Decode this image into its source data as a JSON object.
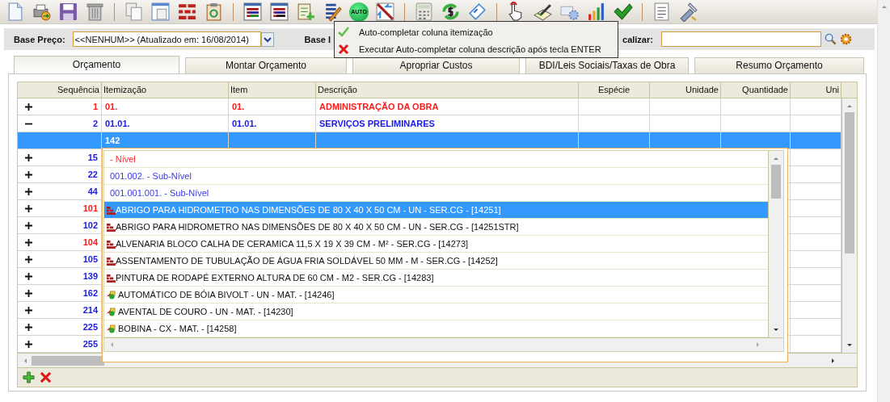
{
  "toolbar": {
    "auto_label": "AUTO"
  },
  "menu": [
    {
      "label": "Auto-completar coluna itemização",
      "checked": true
    },
    {
      "label": "Executar Auto-completar coluna descrição após tecla ENTER",
      "checked": false
    }
  ],
  "filters": {
    "price_base_label": "Base Preço:",
    "price_base_value": "<<NENHUM>> (Atualizado em: 16/08/2014)",
    "label_2": "Base I",
    "search_label": "calizar:"
  },
  "tabs": [
    {
      "label": "Orçamento",
      "selected": true
    },
    {
      "label": "Montar Orçamento",
      "selected": false
    },
    {
      "label": "Apropriar Custos",
      "selected": false
    },
    {
      "label": "BDI/Leis Sociais/Taxas de Obra",
      "selected": false
    },
    {
      "label": "Resumo Orçamento",
      "selected": false
    }
  ],
  "grid": {
    "columns": [
      "Sequência",
      "Itemização",
      "Item",
      "Descrição",
      "Espécie",
      "Unidade",
      "Quantidade",
      "Uni"
    ],
    "rows": [
      {
        "kind": "node",
        "expanded": false,
        "sequence": "1",
        "itemization": "01.",
        "item": "01.",
        "description": "ADMINISTRAÇÃO DA OBRA",
        "color": "#ff1a1a"
      },
      {
        "kind": "node",
        "expanded": true,
        "sequence": "2",
        "itemization": "01.01.",
        "item": "01.01.",
        "description": "SERVIÇOS PRELIMINARES",
        "color": "#1a1ae6"
      },
      {
        "kind": "edit",
        "itemization": "142"
      },
      {
        "kind": "node",
        "expanded": false,
        "sequence": "15",
        "color": "#1a1ae6"
      },
      {
        "kind": "node",
        "expanded": false,
        "sequence": "22",
        "color": "#1a1ae6"
      },
      {
        "kind": "node",
        "expanded": false,
        "sequence": "44",
        "color": "#1a1ae6"
      },
      {
        "kind": "node",
        "expanded": false,
        "sequence": "101",
        "color": "#ff1a1a"
      },
      {
        "kind": "node",
        "expanded": false,
        "sequence": "102",
        "color": "#1a1ae6"
      },
      {
        "kind": "node",
        "expanded": false,
        "sequence": "104",
        "color": "#ff1a1a"
      },
      {
        "kind": "node",
        "expanded": false,
        "sequence": "105",
        "color": "#1a1ae6"
      },
      {
        "kind": "node",
        "expanded": false,
        "sequence": "139",
        "color": "#1a1ae6"
      },
      {
        "kind": "node",
        "expanded": false,
        "sequence": "162",
        "color": "#1a1ae6"
      },
      {
        "kind": "node",
        "expanded": false,
        "sequence": "214",
        "color": "#1a1ae6"
      },
      {
        "kind": "node",
        "expanded": false,
        "sequence": "225",
        "color": "#1a1ae6"
      },
      {
        "kind": "node",
        "expanded": false,
        "sequence": "255",
        "color": "#1a1ae6"
      }
    ]
  },
  "autocomplete": {
    "items": [
      {
        "kind": "level",
        "text": "- Nível",
        "color": "#ff2a2a",
        "selected": false
      },
      {
        "kind": "level",
        "text": "001.002. - Sub-Nível",
        "color": "#3a3ae0",
        "selected": false
      },
      {
        "kind": "level",
        "text": "001.001.001. - Sub-Nível",
        "color": "#3a3ae0",
        "selected": false
      },
      {
        "kind": "service",
        "text": "ABRIGO PARA HIDROMETRO NAS DIMENSÕES DE 80 X 40 X 50 CM - UN - SER.CG - [14251]",
        "selected": true
      },
      {
        "kind": "service",
        "text": "ABRIGO PARA HIDROMETRO NAS DIMENSÕES DE 80 X 40 X 50 CM - UN - SER.CG - [14251STR]",
        "selected": false
      },
      {
        "kind": "service",
        "text": "ALVENARIA BLOCO CALHA DE CERAMICA 11,5 X 19 X 39 CM - M² - SER.CG - [14273]",
        "selected": false
      },
      {
        "kind": "service",
        "text": "ASSENTAMENTO DE TUBULAÇÃO DE ÁGUA FRIA SOLDÁVEL 50 MM - M - SER.CG - [14252]",
        "selected": false
      },
      {
        "kind": "service",
        "text": "PINTURA DE RODAPÉ EXTERNO ALTURA DE 60 CM - M2 - SER.CG - [14283]",
        "selected": false
      },
      {
        "kind": "material",
        "text": "AUTOMÁTICO DE BÓIA BIVOLT - UN - MAT. - [14246]",
        "selected": false
      },
      {
        "kind": "material",
        "text": "AVENTAL DE COURO - UN - MAT. - [14230]",
        "selected": false
      },
      {
        "kind": "material",
        "text": "BOBINA - CX - MAT. - [14258]",
        "selected": false
      }
    ]
  }
}
